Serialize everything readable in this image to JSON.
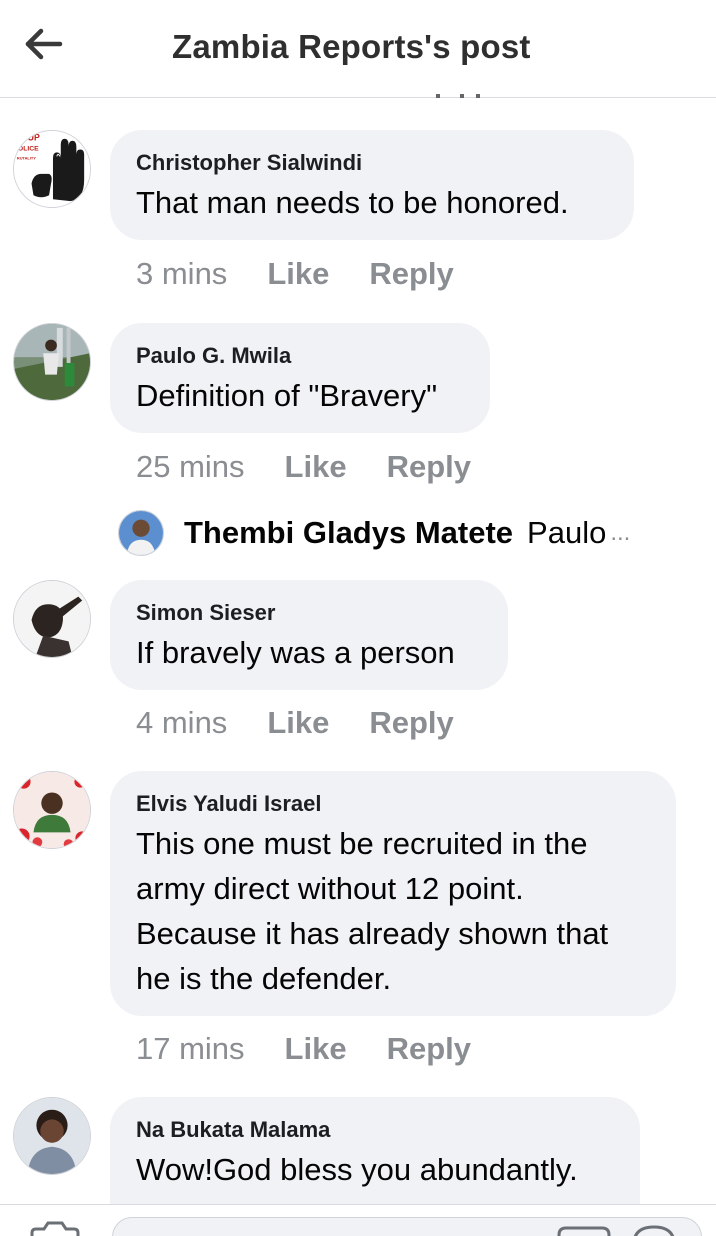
{
  "header": {
    "title": "Zambia Reports's post",
    "back_icon": "arrow-left-icon"
  },
  "comments": [
    {
      "author": "Christopher Sialwindi",
      "text": "That man needs to be honored.",
      "time": "3 mins",
      "like_label": "Like",
      "reply_label": "Reply",
      "avatar_badge_lines": [
        "UP",
        "OLICE",
        "RUTALITY"
      ]
    },
    {
      "author": "Paulo G. Mwila",
      "text": "Definition of \"Bravery\"",
      "time": "25 mins",
      "like_label": "Like",
      "reply_label": "Reply",
      "reply_preview": {
        "author": "Thembi Gladys Matete",
        "snippet": "Paulo",
        "ellipsis": "..."
      }
    },
    {
      "author": "Simon Sieser",
      "text": "If bravely was a person",
      "time": "4 mins",
      "like_label": "Like",
      "reply_label": "Reply"
    },
    {
      "author": "Elvis Yaludi Israel",
      "text_lines": [
        "This one must be recruited in the",
        "army direct without 12 point.",
        "Because it has already shown that",
        "he is the defender."
      ],
      "time": "17 mins",
      "like_label": "Like",
      "reply_label": "Reply"
    },
    {
      "author": "Na Bukata Malama",
      "text": "Wow!God bless you abundantly.",
      "time": null
    }
  ],
  "composer": {
    "camera_icon": "camera-icon",
    "sticker_icon": "sticker-icon",
    "emoji_icon": "emoji-icon"
  },
  "colors": {
    "bubble": "#f0f2f5",
    "meta_text": "#8a8d91",
    "divider": "#d9dbe0"
  }
}
